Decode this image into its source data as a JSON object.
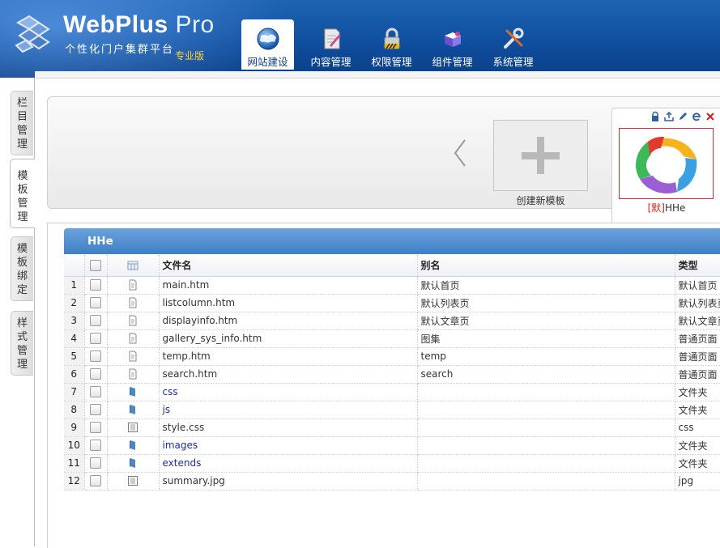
{
  "app": {
    "title": "WebPlus",
    "title_pro": " Pro",
    "subtitle": "个性化门户集群平台",
    "edition": "专业版"
  },
  "nav": [
    {
      "label": "网站建设",
      "icon": "globe-icon",
      "active": true
    },
    {
      "label": "内容管理",
      "icon": "document-icon",
      "active": false
    },
    {
      "label": "权限管理",
      "icon": "lock-icon",
      "active": false
    },
    {
      "label": "组件管理",
      "icon": "puzzle-icon",
      "active": false
    },
    {
      "label": "系统管理",
      "icon": "tools-icon",
      "active": false
    }
  ],
  "side_tabs": [
    {
      "label": "栏目管理",
      "active": false
    },
    {
      "label": "模板管理",
      "active": true
    },
    {
      "label": "模板绑定",
      "active": false
    },
    {
      "label": "样式管理",
      "active": false
    }
  ],
  "templates": {
    "create_label": "创建新模板",
    "items": [
      {
        "default_tag": "[默]",
        "name": "HHe",
        "tools": [
          "lock-icon",
          "export-icon",
          "edit-icon",
          "ie-icon",
          "delete-icon"
        ]
      }
    ]
  },
  "panel": {
    "title": "HHe",
    "columns": {
      "name": "文件名",
      "alias": "别名",
      "type": "类型"
    },
    "rows": [
      {
        "no": "1",
        "icon": "page-icon",
        "name": "main.htm",
        "alias": "默认首页",
        "type": "默认首页"
      },
      {
        "no": "2",
        "icon": "page-icon",
        "name": "listcolumn.htm",
        "alias": "默认列表页",
        "type": "默认列表页"
      },
      {
        "no": "3",
        "icon": "page-icon",
        "name": "displayinfo.htm",
        "alias": "默认文章页",
        "type": "默认文章页"
      },
      {
        "no": "4",
        "icon": "page-icon",
        "name": "gallery_sys_info.htm",
        "alias": "图集",
        "type": "普通页面"
      },
      {
        "no": "5",
        "icon": "page-icon",
        "name": "temp.htm",
        "alias": "temp",
        "type": "普通页面"
      },
      {
        "no": "6",
        "icon": "page-icon",
        "name": "search.htm",
        "alias": "search",
        "type": "普通页面"
      },
      {
        "no": "7",
        "icon": "folder-icon",
        "name": "css",
        "alias": "",
        "type": "文件夹"
      },
      {
        "no": "8",
        "icon": "folder-icon",
        "name": "js",
        "alias": "",
        "type": "文件夹"
      },
      {
        "no": "9",
        "icon": "file-icon",
        "name": "style.css",
        "alias": "",
        "type": "css"
      },
      {
        "no": "10",
        "icon": "folder-icon",
        "name": "images",
        "alias": "",
        "type": "文件夹"
      },
      {
        "no": "11",
        "icon": "folder-icon",
        "name": "extends",
        "alias": "",
        "type": "文件夹"
      },
      {
        "no": "12",
        "icon": "file-icon",
        "name": "summary.jpg",
        "alias": "",
        "type": "jpg"
      }
    ]
  },
  "colors": {
    "header_blue": "#0f4e9e",
    "panel_head_blue": "#3f7fc6",
    "edition_yellow": "#ffd23f",
    "default_tag_red": "#d52222",
    "folder_link_blue": "#1a2ea8"
  }
}
